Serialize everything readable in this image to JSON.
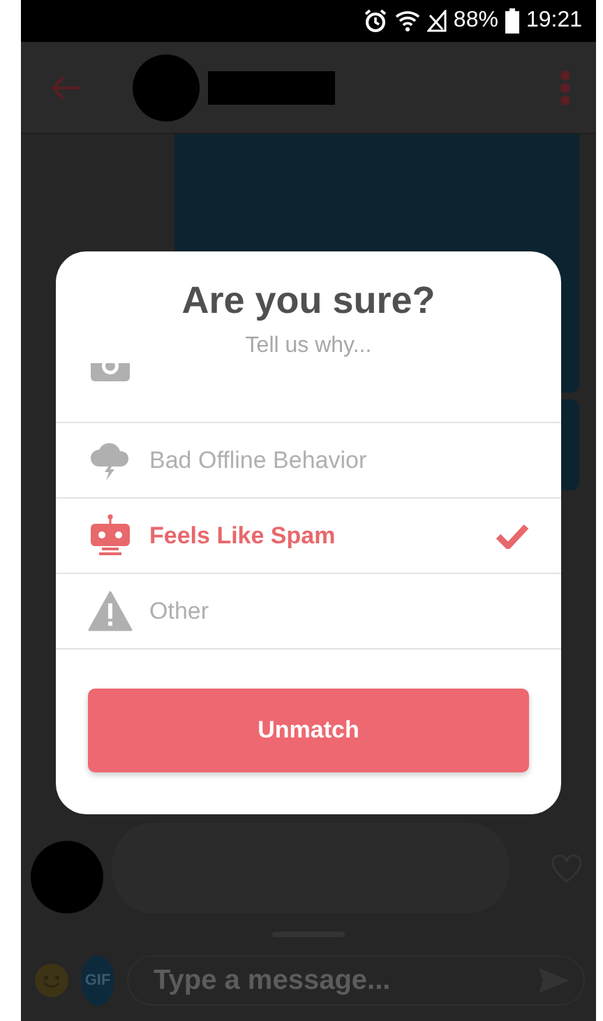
{
  "status_bar": {
    "battery": "88%",
    "time": "19:21"
  },
  "dialog": {
    "title": "Are you sure?",
    "subtitle": "Tell us why...",
    "reasons": [
      {
        "kind": "cloud",
        "label": "Bad Offline Behavior",
        "selected": false
      },
      {
        "kind": "robot",
        "label": "Feels Like Spam",
        "selected": true
      },
      {
        "kind": "warning",
        "label": "Other",
        "selected": false
      }
    ],
    "button": "Unmatch"
  },
  "composer": {
    "gif_button": "GIF",
    "placeholder": "Type a message..."
  }
}
